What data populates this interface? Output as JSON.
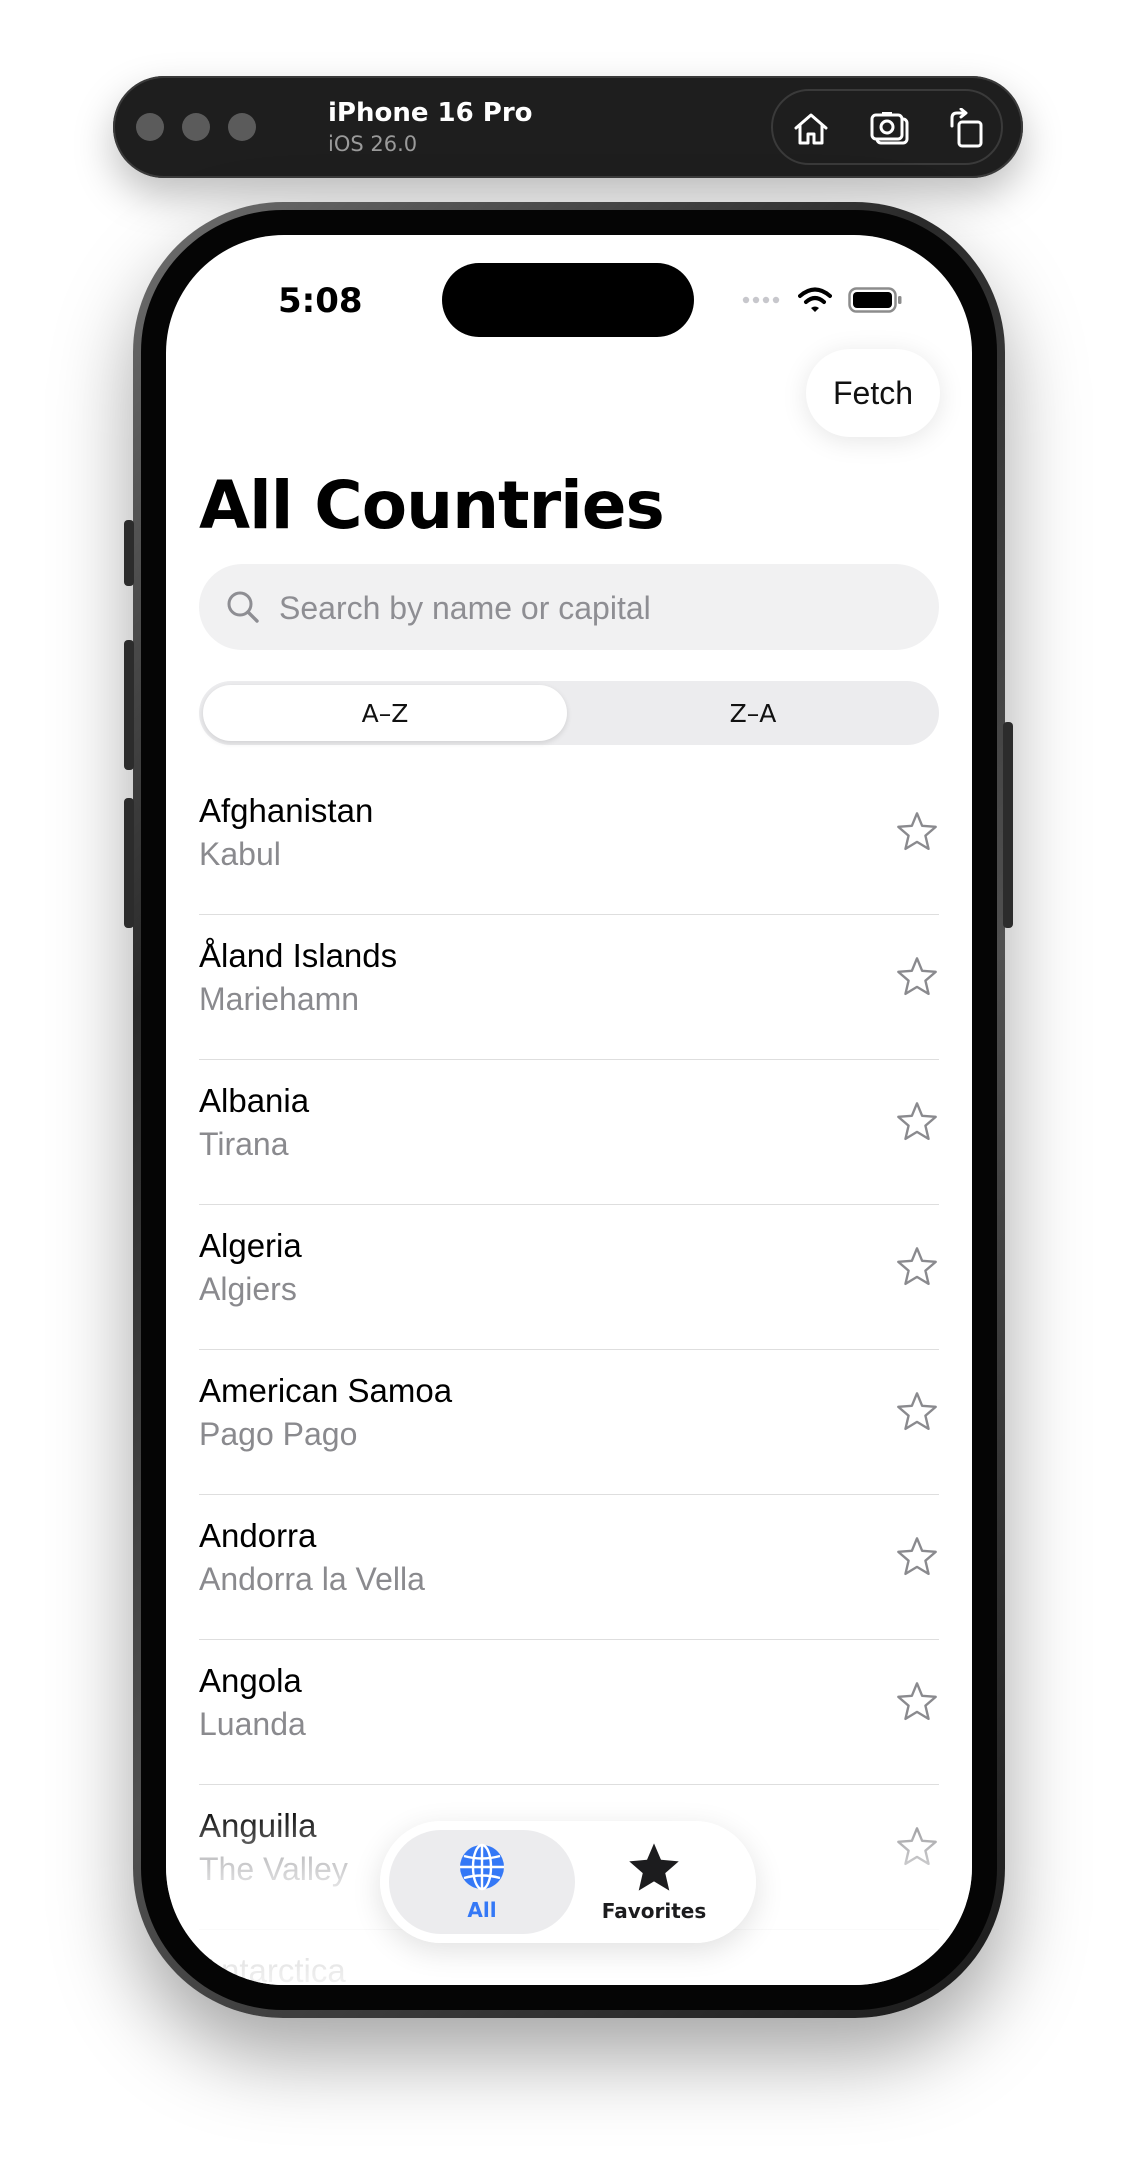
{
  "simulator": {
    "device_name": "iPhone 16 Pro",
    "os_version": "iOS 26.0",
    "controls": [
      "home-icon",
      "screenshot-icon",
      "rotate-icon"
    ]
  },
  "status_bar": {
    "time": "5:08",
    "icons": [
      "cellular-dots-icon",
      "wifi-icon",
      "battery-icon"
    ]
  },
  "toolbar": {
    "fetch_label": "Fetch"
  },
  "page": {
    "title": "All Countries"
  },
  "search": {
    "placeholder": "Search by name or capital",
    "value": ""
  },
  "sort": {
    "options": [
      "A–Z",
      "Z–A"
    ],
    "selected": "A–Z"
  },
  "countries": [
    {
      "name": "Afghanistan",
      "capital": "Kabul",
      "favorite": false
    },
    {
      "name": "Åland Islands",
      "capital": "Mariehamn",
      "favorite": false
    },
    {
      "name": "Albania",
      "capital": "Tirana",
      "favorite": false
    },
    {
      "name": "Algeria",
      "capital": "Algiers",
      "favorite": false
    },
    {
      "name": "American Samoa",
      "capital": "Pago Pago",
      "favorite": false
    },
    {
      "name": "Andorra",
      "capital": "Andorra la Vella",
      "favorite": false
    },
    {
      "name": "Angola",
      "capital": "Luanda",
      "favorite": false
    },
    {
      "name": "Anguilla",
      "capital": "The Valley",
      "favorite": false
    },
    {
      "name": "Antarctica",
      "capital": "",
      "favorite": false
    }
  ],
  "tabbar": {
    "tabs": [
      {
        "label": "All",
        "icon": "globe-icon",
        "active": true
      },
      {
        "label": "Favorites",
        "icon": "star-filled-icon",
        "active": false
      }
    ]
  },
  "colors": {
    "accent": "#3478f6",
    "secondary_text": "#8a8a8e",
    "separator": "#dedede"
  }
}
